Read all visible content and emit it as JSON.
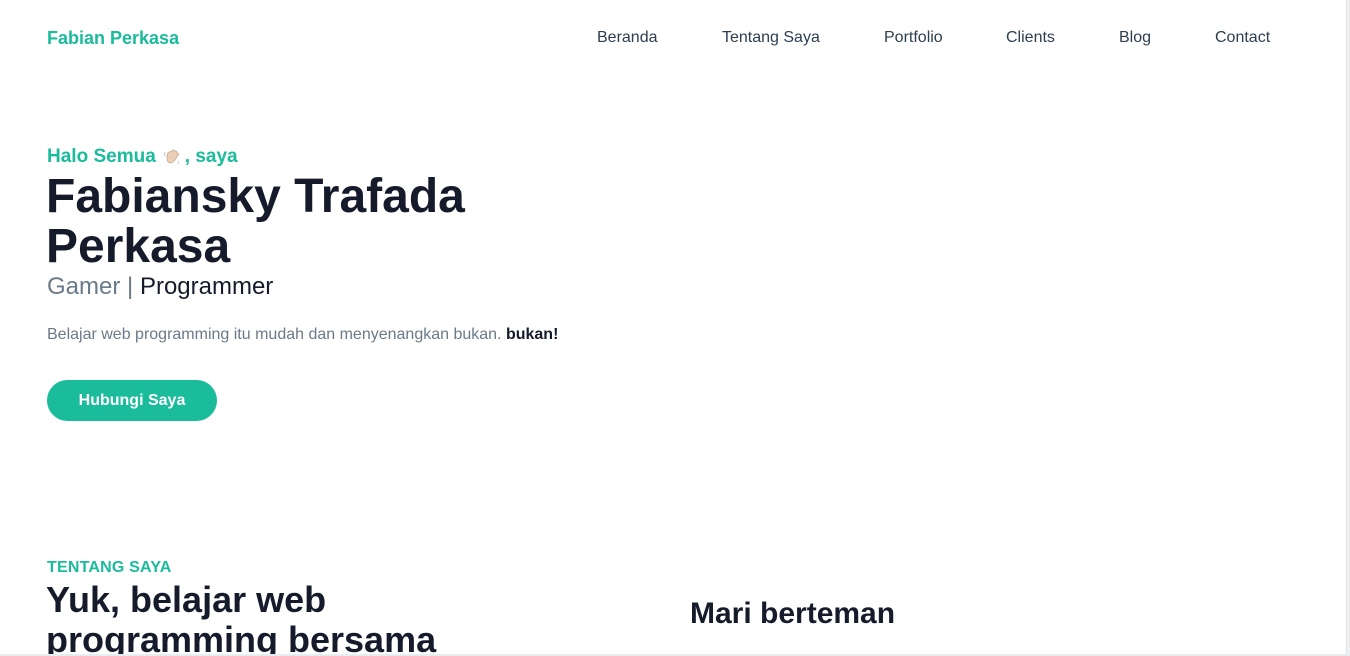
{
  "navbar": {
    "brand": "Fabian Perkasa",
    "links": [
      "Beranda",
      "Tentang Saya",
      "Portfolio",
      "Clients",
      "Blog",
      "Contact"
    ]
  },
  "hero": {
    "greeting_before": "Halo Semua",
    "greeting_icon": "waving-hand-icon",
    "greeting_after": ", saya",
    "name": "Fabiansky Trafada Perkasa",
    "role_muted": "Gamer",
    "role_separator": "|",
    "role_active": "Programmer",
    "description": "Belajar web programming itu mudah dan menyenangkan bukan.",
    "description_emphasis": "bukan!",
    "cta_label": "Hubungi Saya"
  },
  "about": {
    "kicker": "TENTANG SAYA",
    "heading": "Yuk, belajar web programming bersama",
    "friends_heading": "Mari berteman"
  },
  "colors": {
    "accent": "#1abc9c",
    "heading": "#161b2c",
    "muted": "#6b7a89",
    "nav_text": "#2c3e50"
  }
}
